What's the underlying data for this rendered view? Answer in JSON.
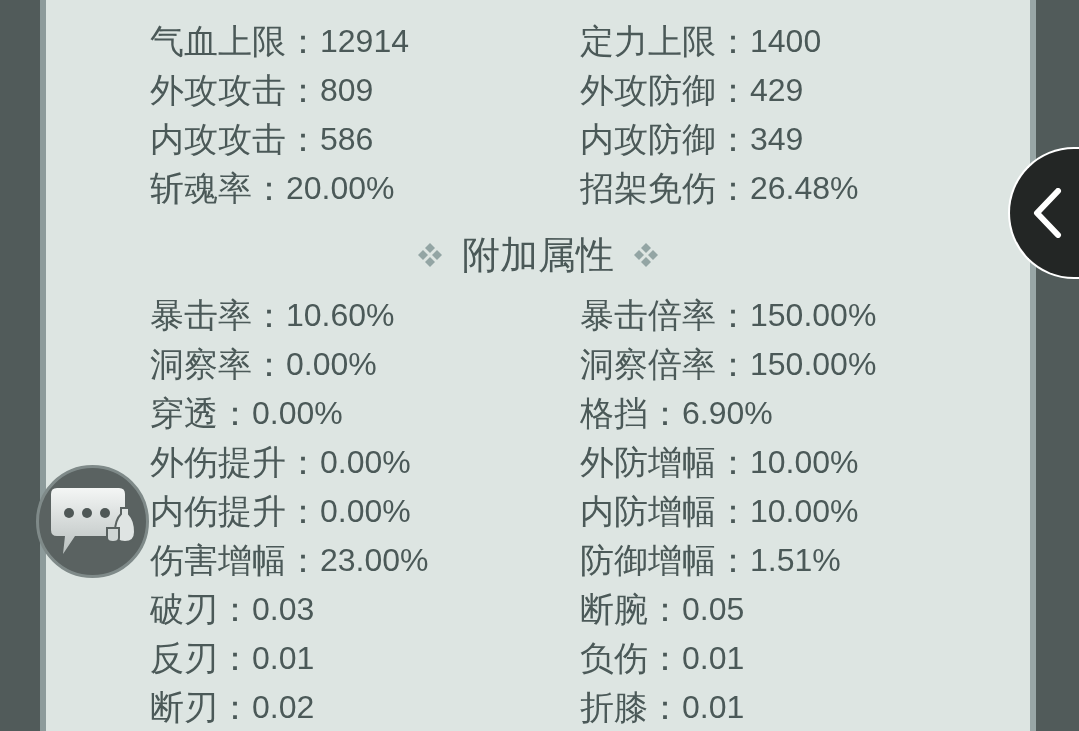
{
  "base_attributes": {
    "stats": [
      {
        "label": "气血上限：",
        "value": "12914"
      },
      {
        "label": "定力上限：",
        "value": "1400"
      },
      {
        "label": "外攻攻击：",
        "value": "809"
      },
      {
        "label": "外攻防御：",
        "value": "429"
      },
      {
        "label": "内攻攻击：",
        "value": "586"
      },
      {
        "label": "内攻防御：",
        "value": "349"
      },
      {
        "label": "斩魂率：",
        "value": "20.00%"
      },
      {
        "label": "招架免伤：",
        "value": "26.48%"
      }
    ]
  },
  "extra_attributes": {
    "title": "附加属性",
    "stats": [
      {
        "label": "暴击率：",
        "value": "10.60%"
      },
      {
        "label": "暴击倍率：",
        "value": "150.00%"
      },
      {
        "label": "洞察率：",
        "value": "0.00%"
      },
      {
        "label": "洞察倍率：",
        "value": "150.00%"
      },
      {
        "label": "穿透：",
        "value": "0.00%"
      },
      {
        "label": "格挡：",
        "value": "6.90%"
      },
      {
        "label": "外伤提升：",
        "value": "0.00%"
      },
      {
        "label": "外防增幅：",
        "value": "10.00%"
      },
      {
        "label": "内伤提升：",
        "value": "0.00%"
      },
      {
        "label": "内防增幅：",
        "value": "10.00%"
      },
      {
        "label": "伤害增幅：",
        "value": "23.00%"
      },
      {
        "label": "防御增幅：",
        "value": "1.51%"
      },
      {
        "label": "破刃：",
        "value": "0.03"
      },
      {
        "label": "断腕：",
        "value": "0.05"
      },
      {
        "label": "反刃：",
        "value": "0.01"
      },
      {
        "label": "负伤：",
        "value": "0.01"
      },
      {
        "label": "断刃：",
        "value": "0.02"
      },
      {
        "label": "折膝：",
        "value": "0.01"
      }
    ]
  }
}
